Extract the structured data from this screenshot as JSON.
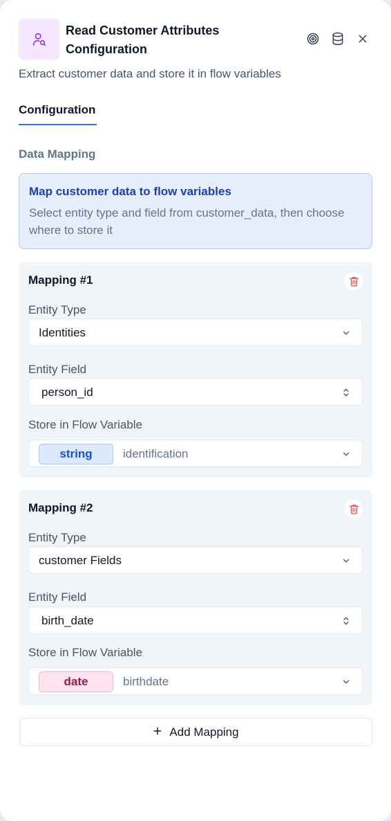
{
  "header": {
    "title": "Read Customer Attributes Configuration",
    "subtitle": "Extract customer data and store it in flow variables",
    "icons": [
      "user-search-icon",
      "target-icon",
      "database-icon",
      "close-icon"
    ]
  },
  "tabs": [
    {
      "label": "Configuration",
      "active": true
    }
  ],
  "section": {
    "label": "Data Mapping"
  },
  "info": {
    "title": "Map customer data to flow variables",
    "description": "Select entity type and field from customer_data, then choose where to store it"
  },
  "labels": {
    "entity_type": "Entity Type",
    "entity_field": "Entity Field",
    "store_variable": "Store in Flow Variable"
  },
  "mappings": [
    {
      "title": "Mapping #1",
      "entity_type": "Identities",
      "entity_field": "person_id",
      "variable_type": "string",
      "variable_name": "identification"
    },
    {
      "title": "Mapping #2",
      "entity_type": "customer Fields",
      "entity_field": "birth_date",
      "variable_type": "date",
      "variable_name": "birthdate"
    }
  ],
  "add_button": {
    "label": "Add Mapping"
  },
  "colors": {
    "accent": "#3b6fd8",
    "icon_bg": "#f3e8ff",
    "icon_fg": "#9333ea",
    "info_bg": "#e6eefc",
    "delete": "#ef4444",
    "string_chip": "#dbe8fd",
    "date_chip": "#fde4ee"
  }
}
